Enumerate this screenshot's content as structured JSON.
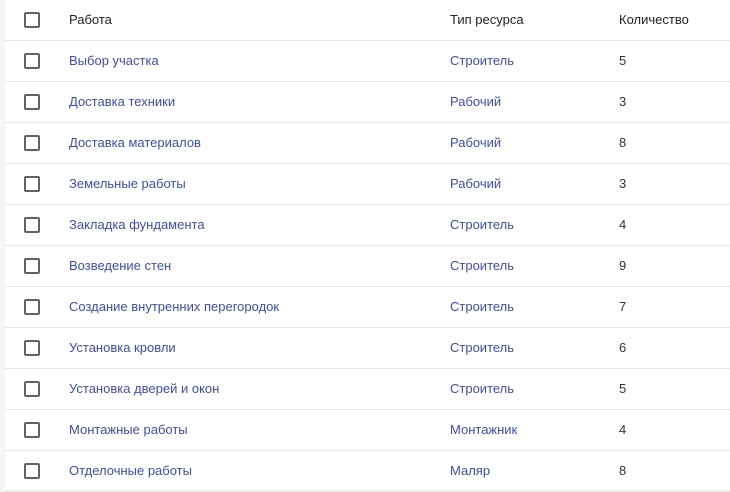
{
  "header": {
    "work": "Работа",
    "type": "Тип ресурса",
    "quantity": "Количество"
  },
  "rows": [
    {
      "work": "Выбор участка",
      "type": "Строитель",
      "quantity": "5"
    },
    {
      "work": "Доставка техники",
      "type": "Рабочий",
      "quantity": "3"
    },
    {
      "work": "Доставка материалов",
      "type": "Рабочий",
      "quantity": "8"
    },
    {
      "work": "Земельные работы",
      "type": "Рабочий",
      "quantity": "3"
    },
    {
      "work": "Закладка фундамента",
      "type": "Строитель",
      "quantity": "4"
    },
    {
      "work": "Возведение стен",
      "type": "Строитель",
      "quantity": "9"
    },
    {
      "work": "Создание внутренних перегородок",
      "type": "Строитель",
      "quantity": "7"
    },
    {
      "work": "Установка кровли",
      "type": "Строитель",
      "quantity": "6"
    },
    {
      "work": "Установка дверей и окон",
      "type": "Строитель",
      "quantity": "5"
    },
    {
      "work": "Монтажные работы",
      "type": "Монтажник",
      "quantity": "4"
    },
    {
      "work": "Отделочные работы",
      "type": "Маляр",
      "quantity": "8"
    }
  ],
  "colors": {
    "link": "#3c4fa8",
    "border": "#e6e6e6",
    "checkbox": "#5f6368"
  }
}
